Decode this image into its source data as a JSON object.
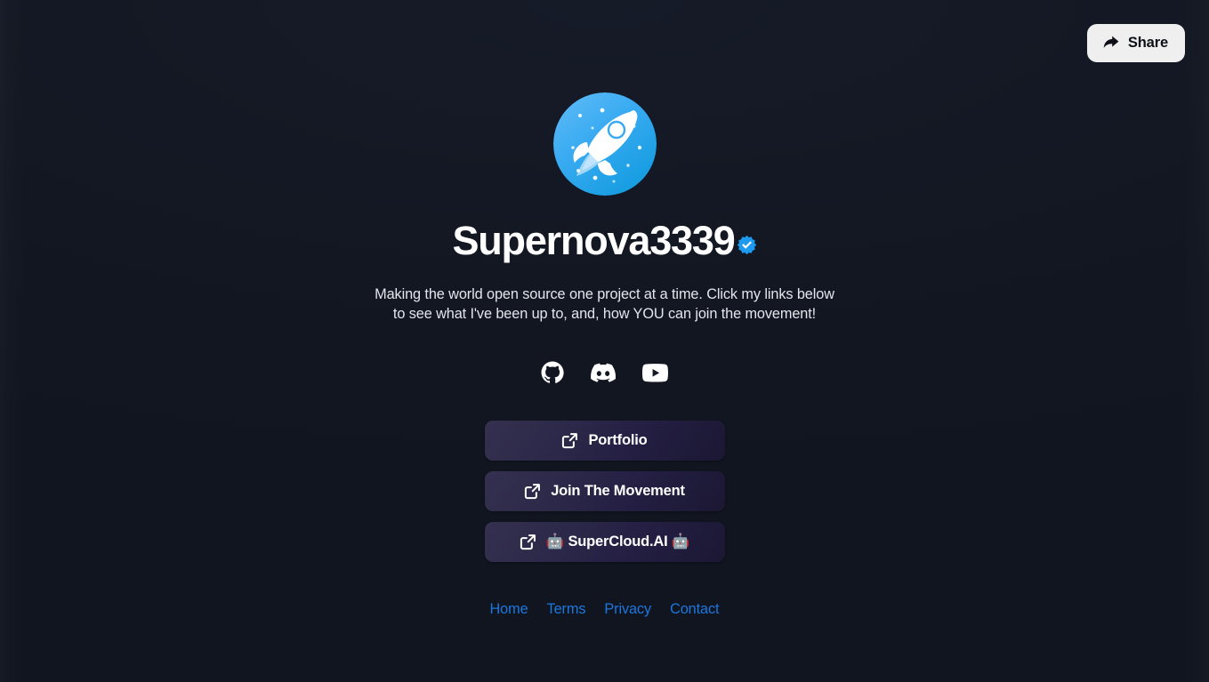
{
  "topbar": {
    "share_label": "Share",
    "share_icon": "share-arrow-icon"
  },
  "profile": {
    "avatar_icon": "rocket-avatar",
    "avatar_colors": {
      "gradient_start": "#5ab7f5",
      "gradient_end": "#159ee0"
    },
    "display_name": "Supernova3339",
    "verified": true,
    "verified_badge_color": "#1d9bf0",
    "bio": "Making the world open source one project at a time. Click my links below to see what I've been up to, and, how YOU can join the movement!"
  },
  "socials": [
    {
      "name": "github",
      "icon": "github-icon",
      "label": "GitHub"
    },
    {
      "name": "discord",
      "icon": "discord-icon",
      "label": "Discord"
    },
    {
      "name": "youtube",
      "icon": "youtube-icon",
      "label": "YouTube"
    }
  ],
  "links": [
    {
      "label": "Portfolio",
      "icon": "external-link-icon"
    },
    {
      "label": "Join The Movement",
      "icon": "external-link-icon"
    },
    {
      "label": "🤖 SuperCloud.AI 🤖",
      "icon": "external-link-icon"
    }
  ],
  "footer": {
    "links": [
      {
        "label": "Home"
      },
      {
        "label": "Terms"
      },
      {
        "label": "Privacy"
      },
      {
        "label": "Contact"
      }
    ],
    "link_color": "#1b77e0"
  },
  "theme": {
    "background": "#141824",
    "text_primary": "#ffffff",
    "text_secondary": "#e3e6ec",
    "button_gradient_start": "#35304f",
    "button_gradient_end": "#1b1733",
    "share_button_bg": "#efeff0"
  }
}
